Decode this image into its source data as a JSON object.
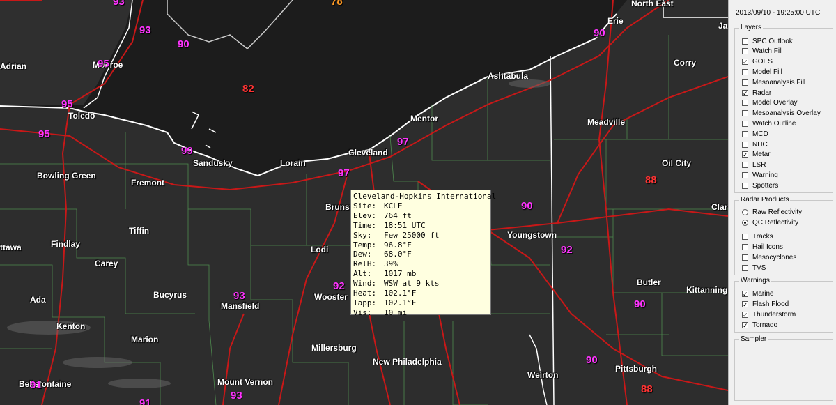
{
  "panel": {
    "datetime": "2013/09/10 - 19:25:00 UTC",
    "layers_title": "Layers",
    "layers": [
      {
        "label": "SPC Outlook",
        "checked": false
      },
      {
        "label": "Watch Fill",
        "checked": false
      },
      {
        "label": "GOES",
        "checked": true
      },
      {
        "label": "Model Fill",
        "checked": false
      },
      {
        "label": "Mesoanalysis Fill",
        "checked": false
      },
      {
        "label": "Radar",
        "checked": true
      },
      {
        "label": "Model Overlay",
        "checked": false
      },
      {
        "label": "Mesoanalysis Overlay",
        "checked": false
      },
      {
        "label": "Watch Outline",
        "checked": false
      },
      {
        "label": "MCD",
        "checked": false
      },
      {
        "label": "NHC",
        "checked": false
      },
      {
        "label": "Metar",
        "checked": true
      },
      {
        "label": "LSR",
        "checked": false
      },
      {
        "label": "Warning",
        "checked": false
      },
      {
        "label": "Spotters",
        "checked": false
      }
    ],
    "radar_title": "Radar Products",
    "radar_modes": [
      {
        "label": "Raw Reflectivity",
        "selected": false
      },
      {
        "label": "QC Reflectivity",
        "selected": true
      }
    ],
    "radar_overlays": [
      {
        "label": "Tracks",
        "checked": false
      },
      {
        "label": "Hail Icons",
        "checked": false
      },
      {
        "label": "Mesocyclones",
        "checked": false
      },
      {
        "label": "TVS",
        "checked": false
      }
    ],
    "warnings_title": "Warnings",
    "warnings": [
      {
        "label": "Marine",
        "checked": true
      },
      {
        "label": "Flash Flood",
        "checked": true
      },
      {
        "label": "Thunderstorm",
        "checked": true
      },
      {
        "label": "Tornado",
        "checked": true
      }
    ],
    "sampler_title": "Sampler"
  },
  "popup": {
    "title": "Cleveland-Hopkins International",
    "rows": [
      {
        "label": "Site:",
        "value": "KCLE"
      },
      {
        "label": "Elev:",
        "value": "764 ft"
      },
      {
        "label": "Time:",
        "value": "18:51 UTC"
      },
      {
        "label": "Sky:",
        "value": "Few 25000 ft"
      },
      {
        "label": "Temp:",
        "value": "96.8°F"
      },
      {
        "label": "Dew:",
        "value": "68.0°F"
      },
      {
        "label": "RelH:",
        "value": "39%"
      },
      {
        "label": "Alt:",
        "value": "1017 mb"
      },
      {
        "label": "Wind:",
        "value": "WSW at 9 kts"
      },
      {
        "label": "Heat:",
        "value": "102.1°F"
      },
      {
        "label": "Tapp:",
        "value": "102.1°F"
      },
      {
        "label": "Vis:",
        "value": "10 mi"
      }
    ]
  },
  "cities": {
    "north_east": "North East",
    "erie": "Erie",
    "ja": "Ja",
    "adrian": "Adrian",
    "monroe": "Monroe",
    "corry": "Corry",
    "toledo": "Toledo",
    "ashtabula": "Ashtabula",
    "mentor": "Mentor",
    "meadville": "Meadville",
    "cleveland": "Cleveland",
    "sandusky": "Sandusky",
    "lorain": "Lorain",
    "oil_city": "Oil City",
    "bowling_green": "Bowling Green",
    "fremont": "Fremont",
    "brunswick": "Brunsw",
    "clar": "Clar",
    "tiffin": "Tiffin",
    "youngstown": "Youngstown",
    "findlay": "Findlay",
    "lodi": "Lodi",
    "ottawa": "ttawa",
    "carey": "Carey",
    "butler": "Butler",
    "bucyrus": "Bucyrus",
    "wooster": "Wooster",
    "kittanning": "Kittanning",
    "ada": "Ada",
    "mansfield": "Mansfield",
    "kenton": "Kenton",
    "marion": "Marion",
    "millersburg": "Millersburg",
    "new_philadelphia": "New Philadelphia",
    "pittsburgh": "Pittsburgh",
    "weirton": "Weirton",
    "bellefontaine": "Bellefontaine",
    "mount_vernon": "Mount Vernon"
  },
  "temps": {
    "t93a": "93",
    "t78": "78",
    "t93b": "93",
    "t90a": "90",
    "t95a": "95",
    "t82": "82",
    "t90erie": "90",
    "t95b": "95",
    "t95c": "95",
    "t99": "99",
    "t97a": "97",
    "t97b": "97",
    "t88a": "88",
    "t90b": "90",
    "t92a": "92",
    "t92b": "92",
    "t93c": "93",
    "t90c": "90",
    "t91a": "91",
    "t93d": "93",
    "t90d": "90",
    "t88b": "88",
    "t91b": "91"
  }
}
